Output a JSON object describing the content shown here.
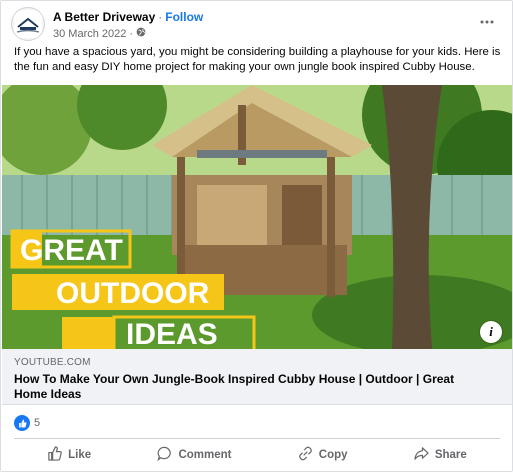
{
  "post": {
    "page_name": "A Better Driveway",
    "separator": "·",
    "follow_label": "Follow",
    "date": "30 March 2022",
    "date_sep": "·",
    "privacy_icon": "globe-icon",
    "more_icon": "more-options-icon",
    "caption": "If you have a spacious yard, you might be considering building a playhouse for your kids. Here is the fun and easy DIY home project for making your own jungle book inspired Cubby House."
  },
  "media": {
    "overlay_lines": [
      "GREAT",
      "OUTDOOR",
      "IDEAS"
    ],
    "overlay_color": "#f5c518",
    "info_label": "i"
  },
  "link": {
    "source": "YOUTUBE.COM",
    "title": "How To Make Your Own Jungle-Book Inspired Cubby House | Outdoor | Great Home Ideas"
  },
  "reactions": {
    "count": "5",
    "icon": "like-reaction-icon"
  },
  "actions": [
    {
      "label": "Like",
      "icon": "thumbs-up-icon"
    },
    {
      "label": "Comment",
      "icon": "comment-icon"
    },
    {
      "label": "Copy",
      "icon": "link-icon"
    },
    {
      "label": "Share",
      "icon": "share-icon"
    }
  ],
  "colors": {
    "accent": "#1877f2",
    "secondary_text": "#65676b",
    "link_bg": "#f0f2f5"
  }
}
